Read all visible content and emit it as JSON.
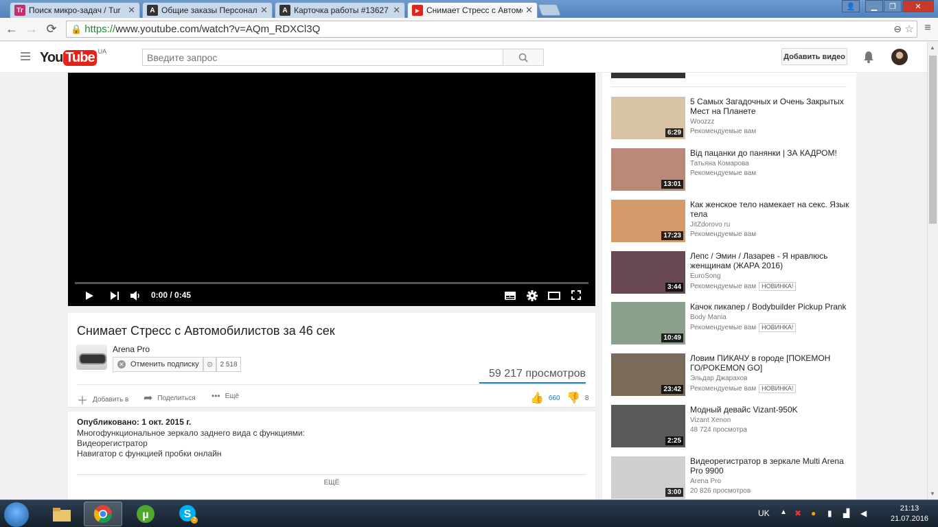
{
  "browser": {
    "tabs": [
      {
        "title": "Поиск микро-задач / Tur",
        "favicon": "toloka-icon"
      },
      {
        "title": "Общие заказы Персонал",
        "favicon": "a-icon"
      },
      {
        "title": "Карточка работы #13627",
        "favicon": "a-icon"
      },
      {
        "title": "Снимает Стресс с Автомо",
        "favicon": "youtube-icon"
      }
    ],
    "url_scheme": "https://",
    "url_rest": "www.youtube.com/watch?v=AQm_RDXCl3Q"
  },
  "header": {
    "logo_you": "You",
    "logo_tube": "Tube",
    "logo_region": "UA",
    "search_placeholder": "Введите запрос",
    "upload_label": "Добавить видео"
  },
  "player": {
    "time": "0:00 / 0:45"
  },
  "video": {
    "title": "Снимает Стресс с Автомобилистов за 46 сек",
    "channel": "Arena Pro",
    "unsubscribe_label": "Отменить подписку",
    "subscriber_count": "2 518",
    "views": "59 217 просмотров",
    "add_to_label": "Добавить в",
    "share_label": "Поделиться",
    "more_label": "Ещё",
    "likes": "660",
    "dislikes": "8"
  },
  "description": {
    "published": "Опубликовано: 1 окт. 2015 г.",
    "lines": [
      "Многофункциональное зеркало заднего вида с функциями:",
      "Видеорегистратор",
      "Навигатор с функцией пробки онлайн"
    ],
    "show_more": "ЕЩЁ"
  },
  "sidebar": {
    "items": [
      {
        "title": "5 Самых Загадочных и Очень Закрытых Мест на Планете",
        "channel": "Woozzz",
        "meta": "Рекомендуемые вам",
        "badge": "",
        "duration": "6:29",
        "color": "#d8c3a5"
      },
      {
        "title": "Від пацанки до панянки | ЗА КАДРОМ!",
        "channel": "Татьяна Комарова",
        "meta": "Рекомендуемые вам",
        "badge": "",
        "duration": "13:01",
        "color": "#b98a7a"
      },
      {
        "title": "Как женское тело намекает на секс. Язык тела",
        "channel": "JitZdorovo ru",
        "meta": "Рекомендуемые вам",
        "badge": "",
        "duration": "17:23",
        "color": "#d49a6a"
      },
      {
        "title": "Лепс / Эмин / Лазарев - Я нравлюсь женщинам (ЖАРА 2016)",
        "channel": "EuroSong",
        "meta": "Рекомендуемые вам",
        "badge": "НОВИНКА!",
        "duration": "3:44",
        "color": "#6a4a52"
      },
      {
        "title": "Качок пикапер / Bodybuilder Pickup Prank",
        "channel": "Body Mania",
        "meta": "Рекомендуемые вам",
        "badge": "НОВИНКА!",
        "duration": "10:49",
        "color": "#8aa08a"
      },
      {
        "title": "Ловим ПИКАЧУ в городе [ПОКЕМОН ГО/POKEMON GO]",
        "channel": "Эльдар Джарахов",
        "meta": "Рекомендуемые вам",
        "badge": "НОВИНКА!",
        "duration": "23:42",
        "color": "#7a6a5a"
      },
      {
        "title": "Модный девайс Vizant-950K",
        "channel": "Vizant Xenon",
        "meta": "48 724 просмотра",
        "badge": "",
        "duration": "2:25",
        "color": "#5a5a5a"
      },
      {
        "title": "Видеорегистратор в зеркале Multi Arena Pro 9900",
        "channel": "Arena Pro",
        "meta": "20 826 просмотров",
        "badge": "",
        "duration": "3:00",
        "color": "#cfcfcf"
      }
    ]
  },
  "taskbar": {
    "lang": "UK",
    "time": "21:13",
    "date": "21.07.2016",
    "skype_badge": "2"
  }
}
